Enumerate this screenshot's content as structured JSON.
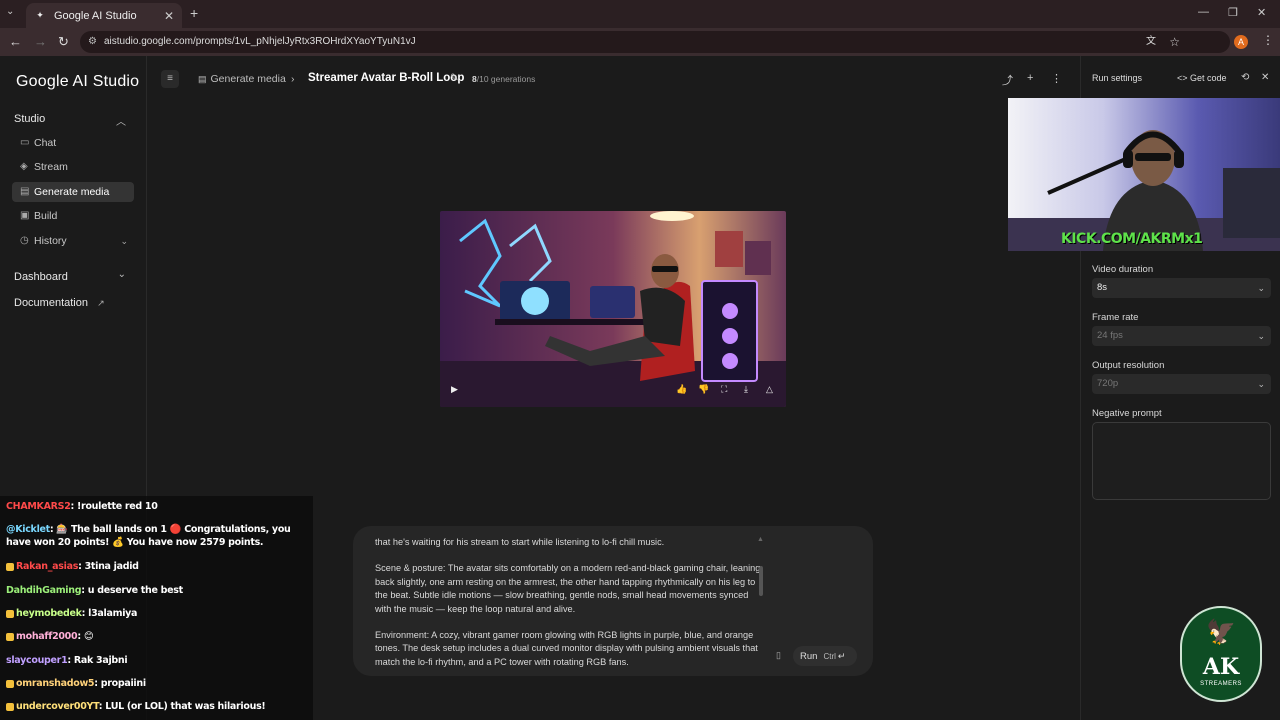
{
  "browser": {
    "tab_title": "Google AI Studio",
    "url": "aistudio.google.com/prompts/1vL_pNhjelJyRtx3ROHrdXYaoYTyuN1vJ",
    "profile_initial": "A"
  },
  "sidebar": {
    "logo": "Google AI Studio",
    "studio_label": "Studio",
    "items": [
      {
        "label": "Chat",
        "icon": "chat-icon"
      },
      {
        "label": "Stream",
        "icon": "stream-icon"
      },
      {
        "label": "Generate media",
        "icon": "media-icon",
        "active": true
      },
      {
        "label": "Build",
        "icon": "build-icon"
      },
      {
        "label": "History",
        "icon": "history-icon"
      }
    ],
    "dashboard_label": "Dashboard",
    "documentation_label": "Documentation"
  },
  "header": {
    "crumb": "Generate media",
    "title": "Streamer Avatar B-Roll Loop",
    "gen_used": "8",
    "gen_total": "/10 generations"
  },
  "run_settings": {
    "title": "Run settings",
    "get_code": "Get code",
    "video_duration_label": "Video duration",
    "video_duration_value": "8s",
    "frame_rate_label": "Frame rate",
    "frame_rate_value": "24 fps",
    "output_resolution_label": "Output resolution",
    "output_resolution_value": "720p",
    "negative_prompt_label": "Negative prompt"
  },
  "webcam": {
    "overlay_text": "KICK.COM/AKRMx1"
  },
  "prompt": {
    "para1": "that he's waiting for his stream to start while listening to lo-fi chill music.",
    "para2": "Scene & posture: The avatar sits comfortably on a modern red-and-black gaming chair, leaning back slightly, one arm resting on the armrest, the other hand tapping rhythmically on his leg to the beat. Subtle idle motions — slow breathing, gentle nods, small head movements synced with the music — keep the loop natural and alive.",
    "para3": "Environment: A cozy, vibrant gamer room glowing with RGB lights in purple, blue, and orange tones. The desk setup includes a dual curved monitor display with pulsing ambient visuals that match the lo-fi rhythm, and a PC tower with rotating RGB fans.",
    "run_label": "Run",
    "run_shortcut": "Ctrl"
  },
  "chat": [
    {
      "user": "CHAMKARS2",
      "text": ": !roulette red 10"
    },
    {
      "user": "@Kicklet",
      "text": ": 🎰 The ball lands on 1 🔴 Congratulations, you have won 20 points! 💰 You have now 2579 points."
    },
    {
      "user": "Rakan_asias",
      "text": ": 3tina jadid"
    },
    {
      "user": "DahdihGaming",
      "text": ": u deserve the best"
    },
    {
      "user": "heymobedek",
      "text": ": l3alamiya"
    },
    {
      "user": "mohaff2000",
      "text": ": 😊"
    },
    {
      "user": "slaycouper1",
      "text": ": Rak 3ajbni"
    },
    {
      "user": "omranshadow5",
      "text": ": propaiini"
    },
    {
      "user": "undercover00YT",
      "text": ": LUL (or LOL) that was hilarious!"
    }
  ],
  "logo_badge": {
    "ak": "AK",
    "sub": "STREAMERS"
  }
}
